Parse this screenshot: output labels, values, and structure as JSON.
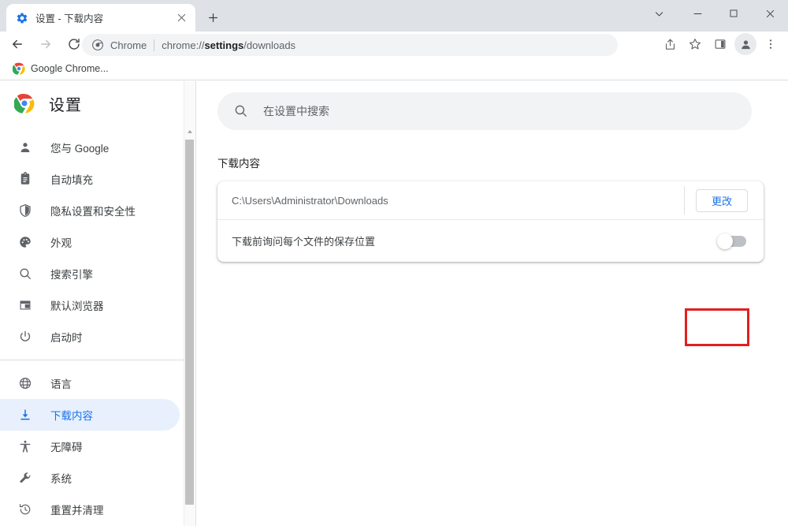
{
  "window": {
    "controls": [
      {
        "name": "tab-search-button",
        "glyph": "chevron-down-icon"
      },
      {
        "name": "minimize-button",
        "glyph": "minimize-icon"
      },
      {
        "name": "maximize-button",
        "glyph": "maximize-icon"
      },
      {
        "name": "close-button",
        "glyph": "close-icon"
      }
    ]
  },
  "tab": {
    "title": "设置 - 下载内容",
    "favicon": "settings-gear-icon",
    "close_label": "×",
    "new_tab_label": "+"
  },
  "toolbar": {
    "back_label": "←",
    "forward_label": "→",
    "reload_label": "⟳",
    "omnibox": {
      "chip_label": "Chrome",
      "url_prefix": "chrome://",
      "url_bold": "settings",
      "url_suffix": "/downloads"
    },
    "actions": [
      {
        "name": "share-icon"
      },
      {
        "name": "bookmark-star-icon"
      },
      {
        "name": "side-panel-icon"
      },
      {
        "name": "profile-avatar-icon"
      },
      {
        "name": "more-menu-icon"
      }
    ]
  },
  "bookmarks": {
    "items": [
      {
        "label": "Google Chrome...",
        "icon": "chrome-logo-icon"
      }
    ]
  },
  "sidebar": {
    "title": "设置",
    "logo": "chrome-logo-icon",
    "items": [
      {
        "label": "您与 Google",
        "icon": "person-icon",
        "selected": false
      },
      {
        "label": "自动填充",
        "icon": "clipboard-icon",
        "selected": false
      },
      {
        "label": "隐私设置和安全性",
        "icon": "shield-icon",
        "selected": false
      },
      {
        "label": "外观",
        "icon": "palette-icon",
        "selected": false
      },
      {
        "label": "搜索引擎",
        "icon": "search-icon",
        "selected": false
      },
      {
        "label": "默认浏览器",
        "icon": "browser-window-icon",
        "selected": false
      },
      {
        "label": "启动时",
        "icon": "power-icon",
        "selected": false
      },
      {
        "label": "语言",
        "icon": "globe-icon",
        "selected": false
      },
      {
        "label": "下载内容",
        "icon": "download-icon",
        "selected": true
      },
      {
        "label": "无障碍",
        "icon": "accessibility-icon",
        "selected": false
      },
      {
        "label": "系统",
        "icon": "wrench-icon",
        "selected": false
      },
      {
        "label": "重置并清理",
        "icon": "restore-clock-icon",
        "selected": false
      }
    ],
    "separator_after_index": 6
  },
  "search": {
    "placeholder": "在设置中搜索",
    "value": "",
    "icon": "search-icon"
  },
  "main": {
    "section_title": "下载内容",
    "rows": [
      {
        "name": "download-location-row",
        "text": "C:\\Users\\Administrator\\Downloads",
        "button_label": "更改"
      },
      {
        "name": "ask-where-to-save-row",
        "text": "下载前询问每个文件的保存位置",
        "toggle_on": false
      }
    ]
  },
  "annotation": {
    "highlight_color": "#e41e1e",
    "target": "ask-where-to-save-toggle"
  },
  "colors": {
    "accent": "#1a73e8",
    "selected_bg": "#e8f0fe",
    "toolbar_bg": "#ffffff",
    "tabstrip_bg": "#dee1e6",
    "omnibox_bg": "#f1f3f4",
    "toggle_off": "#bdc1c6"
  }
}
